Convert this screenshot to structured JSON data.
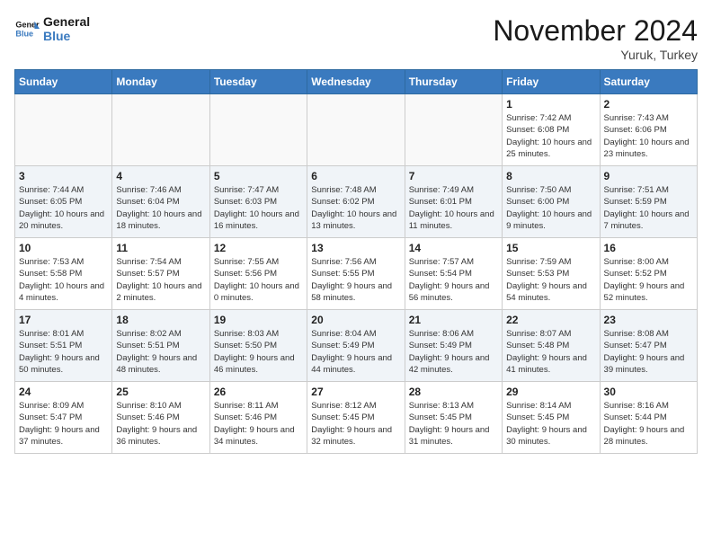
{
  "header": {
    "logo_line1": "General",
    "logo_line2": "Blue",
    "month": "November 2024",
    "location": "Yuruk, Turkey"
  },
  "weekdays": [
    "Sunday",
    "Monday",
    "Tuesday",
    "Wednesday",
    "Thursday",
    "Friday",
    "Saturday"
  ],
  "weeks": [
    [
      {
        "day": "",
        "info": ""
      },
      {
        "day": "",
        "info": ""
      },
      {
        "day": "",
        "info": ""
      },
      {
        "day": "",
        "info": ""
      },
      {
        "day": "",
        "info": ""
      },
      {
        "day": "1",
        "info": "Sunrise: 7:42 AM\nSunset: 6:08 PM\nDaylight: 10 hours and 25 minutes."
      },
      {
        "day": "2",
        "info": "Sunrise: 7:43 AM\nSunset: 6:06 PM\nDaylight: 10 hours and 23 minutes."
      }
    ],
    [
      {
        "day": "3",
        "info": "Sunrise: 7:44 AM\nSunset: 6:05 PM\nDaylight: 10 hours and 20 minutes."
      },
      {
        "day": "4",
        "info": "Sunrise: 7:46 AM\nSunset: 6:04 PM\nDaylight: 10 hours and 18 minutes."
      },
      {
        "day": "5",
        "info": "Sunrise: 7:47 AM\nSunset: 6:03 PM\nDaylight: 10 hours and 16 minutes."
      },
      {
        "day": "6",
        "info": "Sunrise: 7:48 AM\nSunset: 6:02 PM\nDaylight: 10 hours and 13 minutes."
      },
      {
        "day": "7",
        "info": "Sunrise: 7:49 AM\nSunset: 6:01 PM\nDaylight: 10 hours and 11 minutes."
      },
      {
        "day": "8",
        "info": "Sunrise: 7:50 AM\nSunset: 6:00 PM\nDaylight: 10 hours and 9 minutes."
      },
      {
        "day": "9",
        "info": "Sunrise: 7:51 AM\nSunset: 5:59 PM\nDaylight: 10 hours and 7 minutes."
      }
    ],
    [
      {
        "day": "10",
        "info": "Sunrise: 7:53 AM\nSunset: 5:58 PM\nDaylight: 10 hours and 4 minutes."
      },
      {
        "day": "11",
        "info": "Sunrise: 7:54 AM\nSunset: 5:57 PM\nDaylight: 10 hours and 2 minutes."
      },
      {
        "day": "12",
        "info": "Sunrise: 7:55 AM\nSunset: 5:56 PM\nDaylight: 10 hours and 0 minutes."
      },
      {
        "day": "13",
        "info": "Sunrise: 7:56 AM\nSunset: 5:55 PM\nDaylight: 9 hours and 58 minutes."
      },
      {
        "day": "14",
        "info": "Sunrise: 7:57 AM\nSunset: 5:54 PM\nDaylight: 9 hours and 56 minutes."
      },
      {
        "day": "15",
        "info": "Sunrise: 7:59 AM\nSunset: 5:53 PM\nDaylight: 9 hours and 54 minutes."
      },
      {
        "day": "16",
        "info": "Sunrise: 8:00 AM\nSunset: 5:52 PM\nDaylight: 9 hours and 52 minutes."
      }
    ],
    [
      {
        "day": "17",
        "info": "Sunrise: 8:01 AM\nSunset: 5:51 PM\nDaylight: 9 hours and 50 minutes."
      },
      {
        "day": "18",
        "info": "Sunrise: 8:02 AM\nSunset: 5:51 PM\nDaylight: 9 hours and 48 minutes."
      },
      {
        "day": "19",
        "info": "Sunrise: 8:03 AM\nSunset: 5:50 PM\nDaylight: 9 hours and 46 minutes."
      },
      {
        "day": "20",
        "info": "Sunrise: 8:04 AM\nSunset: 5:49 PM\nDaylight: 9 hours and 44 minutes."
      },
      {
        "day": "21",
        "info": "Sunrise: 8:06 AM\nSunset: 5:49 PM\nDaylight: 9 hours and 42 minutes."
      },
      {
        "day": "22",
        "info": "Sunrise: 8:07 AM\nSunset: 5:48 PM\nDaylight: 9 hours and 41 minutes."
      },
      {
        "day": "23",
        "info": "Sunrise: 8:08 AM\nSunset: 5:47 PM\nDaylight: 9 hours and 39 minutes."
      }
    ],
    [
      {
        "day": "24",
        "info": "Sunrise: 8:09 AM\nSunset: 5:47 PM\nDaylight: 9 hours and 37 minutes."
      },
      {
        "day": "25",
        "info": "Sunrise: 8:10 AM\nSunset: 5:46 PM\nDaylight: 9 hours and 36 minutes."
      },
      {
        "day": "26",
        "info": "Sunrise: 8:11 AM\nSunset: 5:46 PM\nDaylight: 9 hours and 34 minutes."
      },
      {
        "day": "27",
        "info": "Sunrise: 8:12 AM\nSunset: 5:45 PM\nDaylight: 9 hours and 32 minutes."
      },
      {
        "day": "28",
        "info": "Sunrise: 8:13 AM\nSunset: 5:45 PM\nDaylight: 9 hours and 31 minutes."
      },
      {
        "day": "29",
        "info": "Sunrise: 8:14 AM\nSunset: 5:45 PM\nDaylight: 9 hours and 30 minutes."
      },
      {
        "day": "30",
        "info": "Sunrise: 8:16 AM\nSunset: 5:44 PM\nDaylight: 9 hours and 28 minutes."
      }
    ]
  ]
}
